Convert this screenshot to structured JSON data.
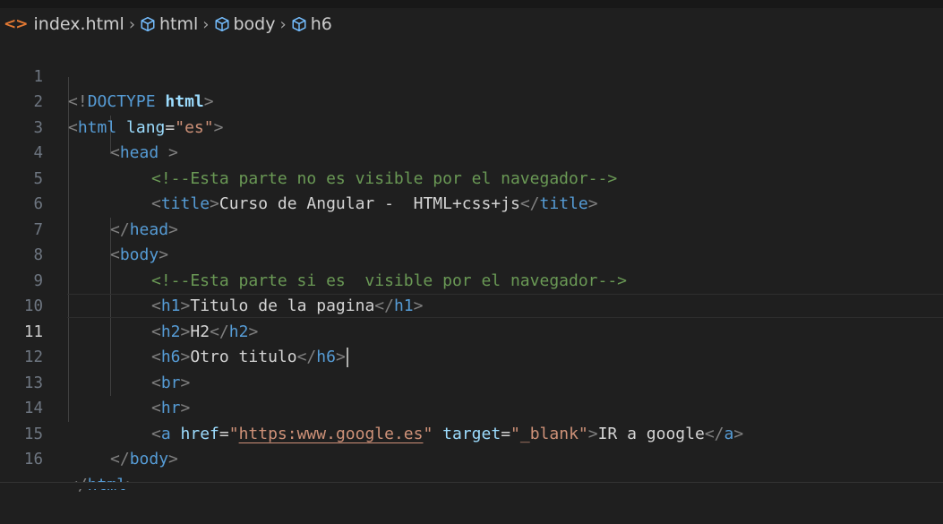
{
  "breadcrumb": {
    "file": "index.html",
    "items": [
      "html",
      "body",
      "h6"
    ]
  },
  "editor": {
    "active_line": 11,
    "lines": [
      {
        "n": "1"
      },
      {
        "n": "2"
      },
      {
        "n": "3"
      },
      {
        "n": "4"
      },
      {
        "n": "5"
      },
      {
        "n": "6"
      },
      {
        "n": "7"
      },
      {
        "n": "8"
      },
      {
        "n": "9"
      },
      {
        "n": "10"
      },
      {
        "n": "11"
      },
      {
        "n": "12"
      },
      {
        "n": "13"
      },
      {
        "n": "14"
      },
      {
        "n": "15"
      },
      {
        "n": "16"
      }
    ],
    "code": {
      "l1": {
        "open": "<!",
        "doctype": "DOCTYPE",
        "sp": " ",
        "kw": "html",
        "close": ">"
      },
      "l2": {
        "lt": "<",
        "tag": "html",
        "sp": " ",
        "attr": "lang",
        "eq": "=",
        "val": "\"es\"",
        "gt": ">"
      },
      "l3": {
        "lt": "<",
        "tag": "head",
        "sp": " ",
        "gt": ">"
      },
      "l4": {
        "comment": "<!--Esta parte no es visible por el navegador-->"
      },
      "l5": {
        "lt": "<",
        "tag": "title",
        "gt": ">",
        "text": "Curso de Angular -  HTML+css+js",
        "clt": "</",
        "ctag": "title",
        "cgt": ">"
      },
      "l6": {
        "clt": "</",
        "ctag": "head",
        "cgt": ">"
      },
      "l7": {
        "lt": "<",
        "tag": "body",
        "gt": ">"
      },
      "l8": {
        "comment": "<!--Esta parte si es  visible por el navegador-->"
      },
      "l9": {
        "lt": "<",
        "tag": "h1",
        "gt": ">",
        "text": "Titulo de la pagina",
        "clt": "</",
        "ctag": "h1",
        "cgt": ">"
      },
      "l10": {
        "lt": "<",
        "tag": "h2",
        "gt": ">",
        "text": "H2",
        "clt": "</",
        "ctag": "h2",
        "cgt": ">"
      },
      "l11": {
        "lt": "<",
        "tag": "h6",
        "gt": ">",
        "text": "Otro titulo",
        "clt": "</",
        "ctag": "h6",
        "cgt": ">"
      },
      "l12": {
        "lt": "<",
        "tag": "br",
        "gt": ">"
      },
      "l13": {
        "lt": "<",
        "tag": "hr",
        "gt": ">"
      },
      "l14": {
        "lt": "<",
        "tag": "a",
        "sp1": " ",
        "attr1": "href",
        "eq1": "=",
        "q1": "\"",
        "link": "https:www.google.es",
        "q2": "\"",
        "sp2": " ",
        "attr2": "target",
        "eq2": "=",
        "val2": "\"_blank\"",
        "gt": ">",
        "text": "IR a google",
        "clt": "</",
        "ctag": "a",
        "cgt": ">"
      },
      "l15": {
        "clt": "</",
        "ctag": "body",
        "cgt": ">"
      },
      "l16": {
        "clt": "</",
        "ctag": "html",
        "cgt": ">"
      }
    }
  },
  "colors": {
    "background": "#1f1f1f",
    "tag": "#569cd6",
    "attribute": "#9cdcfe",
    "string": "#ce9178",
    "comment": "#6a9955",
    "bracket": "#808080",
    "text": "#d4d4d4",
    "html_file_icon": "#e37933"
  },
  "icons": {
    "file": "html-file-icon",
    "symbol": "cube-symbol-icon",
    "separator": "chevron-right-icon"
  }
}
